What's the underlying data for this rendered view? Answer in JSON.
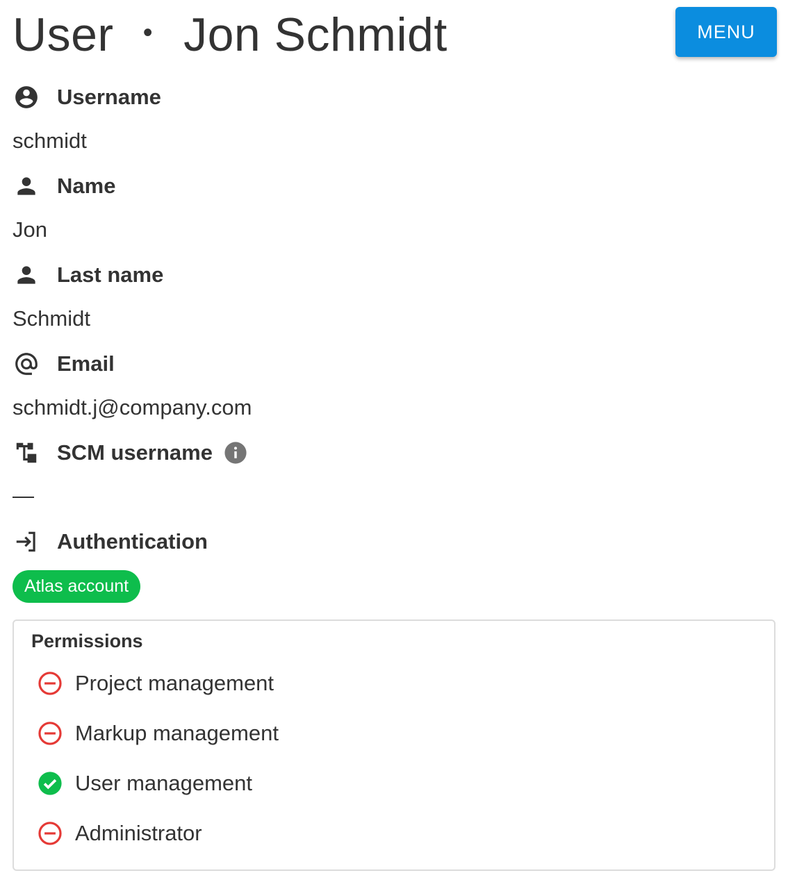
{
  "header": {
    "title_prefix": "User",
    "separator": "•",
    "title_name": "Jon Schmidt",
    "menu_label": "MENU"
  },
  "fields": {
    "username": {
      "label": "Username",
      "value": "schmidt",
      "icon": "account-circle-icon"
    },
    "name": {
      "label": "Name",
      "value": "Jon",
      "icon": "person-icon"
    },
    "last_name": {
      "label": "Last name",
      "value": "Schmidt",
      "icon": "person-icon"
    },
    "email": {
      "label": "Email",
      "value": "schmidt.j@company.com",
      "icon": "at-sign-icon"
    },
    "scm_username": {
      "label": "SCM username",
      "value": "—",
      "icon": "scm-tree-icon",
      "info_icon": "info-icon"
    },
    "authentication": {
      "label": "Authentication",
      "value": "Atlas account",
      "icon": "login-icon"
    }
  },
  "permissions": {
    "title": "Permissions",
    "items": [
      {
        "label": "Project management",
        "granted": false,
        "icon": "denied-icon"
      },
      {
        "label": "Markup management",
        "granted": false,
        "icon": "denied-icon"
      },
      {
        "label": "User management",
        "granted": true,
        "icon": "check-circle-icon"
      },
      {
        "label": "Administrator",
        "granted": false,
        "icon": "denied-icon"
      }
    ]
  },
  "colors": {
    "primary": "#0b8ddf",
    "success": "#0ebd4c",
    "danger": "#e53935",
    "text": "#333333"
  }
}
